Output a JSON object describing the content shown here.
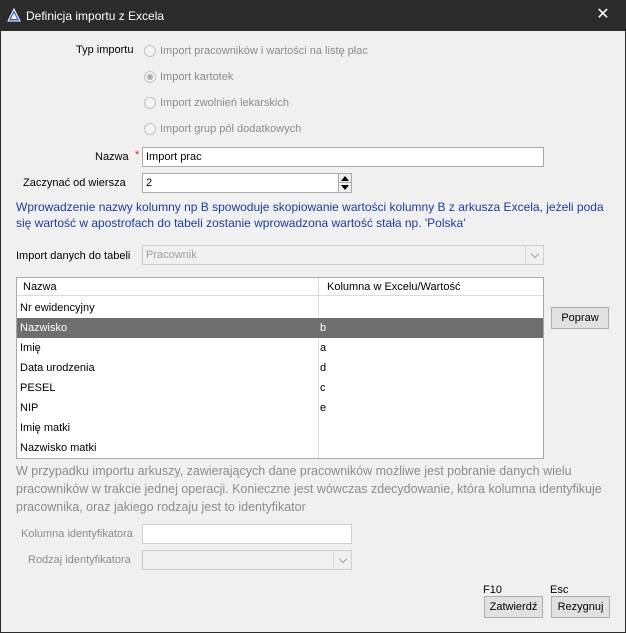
{
  "window": {
    "title": "Definicja importu z Excela",
    "close_glyph": "✕"
  },
  "typ_importu": {
    "label": "Typ importu",
    "options": [
      {
        "label": "Import pracowników i wartości na listę płac",
        "checked": false
      },
      {
        "label": "Import kartotek",
        "checked": true
      },
      {
        "label": "Import zwolnień lekarskich",
        "checked": false
      },
      {
        "label": "Import grup pól dodatkowych",
        "checked": false
      }
    ]
  },
  "nazwa": {
    "label": "Nazwa",
    "required_mark": "*",
    "value": "Import prac"
  },
  "zaczynac": {
    "label": "Zaczynać od wiersza",
    "value": "2"
  },
  "info": "Wprowadzenie nazwy kolumny np B spowoduje skopiowanie wartości kolumny B z arkusza Excela, jeżeli poda się wartość w apostrofach do tabeli zostanie wprowadzona wartość stała np. 'Polska'",
  "import_tabela": {
    "label": "Import danych do tabeli",
    "value": "Pracownik"
  },
  "grid": {
    "headers": [
      "Nazwa",
      "Kolumna w Excelu/Wartość"
    ],
    "rows": [
      {
        "name": "Nr ewidencyjny",
        "value": ""
      },
      {
        "name": "Nazwisko",
        "value": "b",
        "selected": true
      },
      {
        "name": "Imię",
        "value": "a"
      },
      {
        "name": "Data urodzenia",
        "value": "d"
      },
      {
        "name": "PESEL",
        "value": "c"
      },
      {
        "name": "NIP",
        "value": "e"
      },
      {
        "name": "Imię matki",
        "value": ""
      },
      {
        "name": "Nazwisko matki",
        "value": ""
      }
    ],
    "selected_color": "#6e6e6e"
  },
  "popraw_button": "Popraw",
  "description": "W przypadku importu arkuszy, zawierających dane pracowników możliwe jest pobranie danych wielu pracowników w trakcie jednej operacji. Konieczne jest wówczas zdecydowanie, która kolumna identyfikuje pracownika, oraz jakiego rodzaju jest to identyfikator",
  "kolumna_id": {
    "label": "Kolumna identyfikatora",
    "value": ""
  },
  "rodzaj_id": {
    "label": "Rodzaj identyfikatora",
    "value": ""
  },
  "footer": {
    "zatwierdz": {
      "shortcut": "F10",
      "label": "Zatwierdź"
    },
    "rezygnuj": {
      "shortcut": "Esc",
      "label": "Rezygnuj"
    }
  },
  "colors": {
    "title_bar": "#2b2b2b",
    "info_text": "#1c3ca0",
    "required": "#dd2222"
  },
  "icons": {
    "app": "blue-triangle-icon",
    "close": "close-icon",
    "spin_up": "triangle-up-icon",
    "spin_down": "triangle-down-icon",
    "combo": "chevron-down-icon"
  }
}
